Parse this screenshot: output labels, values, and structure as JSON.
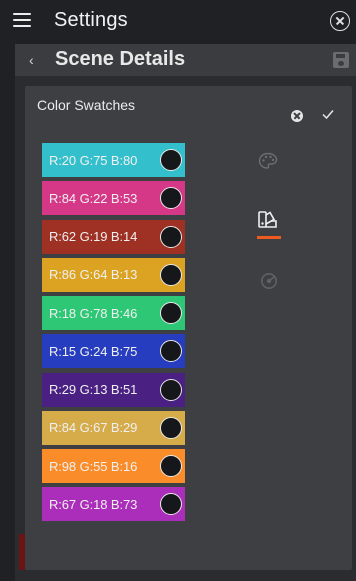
{
  "header": {
    "title": "Settings",
    "menu_icon": "hamburger-menu-icon",
    "close_icon": "close-circle-icon"
  },
  "subheader": {
    "title": "Scene Details",
    "back_icon": "chevron-left-icon",
    "save_icon": "save-icon"
  },
  "panel": {
    "title": "Color Swatches",
    "close_icon": "close-circle-icon",
    "confirm_icon": "check-icon"
  },
  "swatches": [
    {
      "label": "R:20 G:75 B:80",
      "color": "#33c0cc"
    },
    {
      "label": "R:84 G:22 B:53",
      "color": "#d63888"
    },
    {
      "label": "R:62 G:19 B:14",
      "color": "#9e3124"
    },
    {
      "label": "R:86 G:64 B:13",
      "color": "#dba321"
    },
    {
      "label": "R:18 G:78 B:46",
      "color": "#2ec776"
    },
    {
      "label": "R:15 G:24 B:75",
      "color": "#263dbf"
    },
    {
      "label": "R:29 G:13 B:51",
      "color": "#4a2182"
    },
    {
      "label": "R:84 G:67 B:29",
      "color": "#d6ab4a"
    },
    {
      "label": "R:98 G:55 B:16",
      "color": "#fa8c29"
    },
    {
      "label": "R:67 G:18 B:73",
      "color": "#ab2ebb"
    }
  ],
  "side_tabs": [
    {
      "icon": "palette-icon",
      "active": false
    },
    {
      "icon": "swatches-icon",
      "active": true
    },
    {
      "icon": "color-picker-icon",
      "active": false
    }
  ],
  "colors": {
    "accent": "#ef5a1e",
    "background": "#1f2124",
    "panel": "#3d3f42"
  }
}
